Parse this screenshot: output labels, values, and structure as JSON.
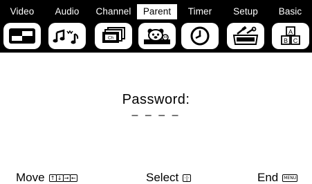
{
  "tabs": [
    {
      "label": "Video",
      "icon": "video-screen-icon",
      "active": false
    },
    {
      "label": "Audio",
      "icon": "music-notes-icon",
      "active": false
    },
    {
      "label": "Channel",
      "icon": "channel-stack-icon",
      "active": false
    },
    {
      "label": "Parent",
      "icon": "teddy-bear-icon",
      "active": true
    },
    {
      "label": "Timer",
      "icon": "clock-icon",
      "active": false
    },
    {
      "label": "Setup",
      "icon": "toolbox-icon",
      "active": false
    },
    {
      "label": "Basic",
      "icon": "abc-blocks-icon",
      "active": false
    }
  ],
  "password": {
    "label": "Password:",
    "value": "– – – –"
  },
  "footer": {
    "move_label": "Move",
    "move_keys": [
      "↑",
      "↓",
      "→",
      "←"
    ],
    "select_label": "Select",
    "select_key": "·|·",
    "end_label": "End",
    "end_key": "MENU"
  },
  "colors": {
    "bar_background": "#000000",
    "active_tab_background": "#ffffff",
    "page_background": "#ffffff"
  }
}
